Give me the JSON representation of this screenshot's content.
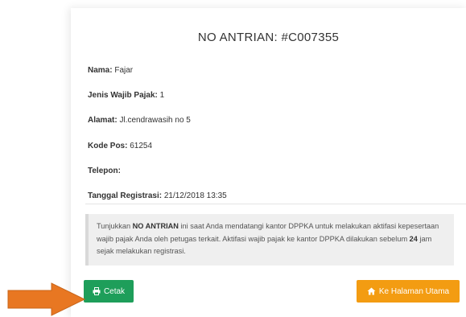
{
  "title": "NO ANTRIAN: #C007355",
  "fields": [
    {
      "label": "Nama:",
      "value": " Fajar"
    },
    {
      "label": "Jenis Wajib Pajak:",
      "value": " 1"
    },
    {
      "label": "Alamat:",
      "value": " Jl.cendrawasih no 5"
    },
    {
      "label": "Kode Pos:",
      "value": " 61254"
    },
    {
      "label": "Telepon:",
      "value": ""
    },
    {
      "label": "Tanggal Registrasi:",
      "value": " 21/12/2018 13:35"
    }
  ],
  "notice": {
    "part1": "Tunjukkan ",
    "bold1": "NO ANTRIAN",
    "part2": " ini saat Anda mendatangi kantor DPPKA untuk melakukan aktifasi kepesertaan wajib pajak Anda oleh petugas terkait. Aktifasi wajib pajak ke kantor DPPKA dilakukan sebelum ",
    "bold2": "24",
    "part3": " jam sejak melakukan registrasi."
  },
  "buttons": {
    "print_label": "Cetak",
    "home_label": "Ke Halaman Utama"
  },
  "colors": {
    "print_button": "#1e9e5a",
    "home_button": "#f39c12",
    "arrow": "#e87722"
  },
  "icons": {
    "print": "print-icon",
    "home": "home-icon",
    "arrow": "arrow-right-icon"
  }
}
